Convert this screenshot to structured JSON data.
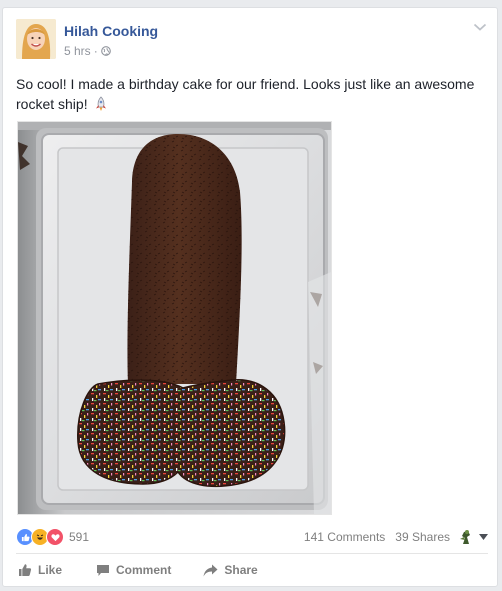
{
  "post": {
    "author": "Hilah Cooking",
    "time": "5 hrs",
    "time_separator": "·",
    "privacy_icon": "globe-icon",
    "text": "So cool! I made a birthday cake for our friend. Looks just like an awesome rocket ship!",
    "text_emoji": "rocket-icon"
  },
  "stats": {
    "reactions": [
      "like",
      "haha",
      "love"
    ],
    "reaction_count": "591",
    "comments": "141 Comments",
    "shares": "39 Shares"
  },
  "actions": {
    "like": "Like",
    "comment": "Comment",
    "share": "Share"
  },
  "colors": {
    "link": "#365899",
    "like": "#5890ff",
    "haha": "#f7b125",
    "love": "#f25268",
    "muted": "#90949c"
  }
}
